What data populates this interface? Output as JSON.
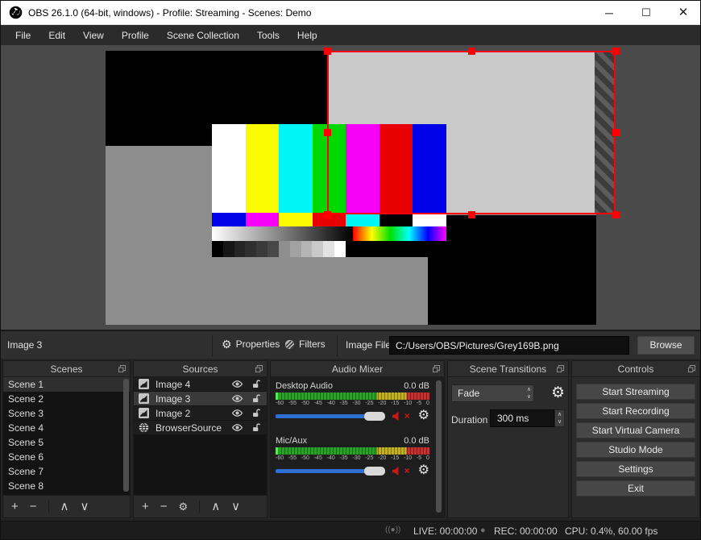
{
  "window": {
    "title": "OBS 26.1.0 (64-bit, windows) - Profile: Streaming - Scenes: Demo",
    "minimize": "–",
    "maximize": "❐",
    "close": "×"
  },
  "menu": {
    "items": [
      "File",
      "Edit",
      "View",
      "Profile",
      "Scene Collection",
      "Tools",
      "Help"
    ]
  },
  "preview": {
    "background_color": "#4a4a4a",
    "canvas_color": "#8d8d8d",
    "selected_image_color": "#c9c9c9",
    "selection_color": "#ff0000",
    "colorbar": {
      "main_colors": [
        "#ffffff",
        "#fbfb00",
        "#00f6f6",
        "#00d800",
        "#f600f6",
        "#e90000",
        "#0000e9"
      ],
      "small_colors": [
        "#0000e9",
        "#f600f6",
        "#fbfb00",
        "#e90000",
        "#00f6f6",
        "#000000",
        "#ffffff"
      ],
      "grayscale_gradient": [
        "#ffffff",
        "#000000"
      ],
      "rainbow_gradient": [
        "#ff0000",
        "#ffff00",
        "#00e000",
        "#00ffff",
        "#0000ff",
        "#ff00ff"
      ],
      "step_colors": [
        "#000000",
        "#161616",
        "#242424",
        "#2f2f2f",
        "#3a3a3a",
        "#484848",
        "#8f8f8f",
        "#a2a2a2",
        "#b5b5b5",
        "#c9c9c9",
        "#e2e2e2",
        "#ffffff"
      ]
    }
  },
  "toolbar": {
    "selected_source": "Image 3",
    "properties_label": "Properties",
    "filters_label": "Filters",
    "image_file_label": "Image File",
    "image_file_value": "C:/Users/OBS/Pictures/Grey169B.png",
    "browse_label": "Browse"
  },
  "scenes": {
    "title": "Scenes",
    "items": [
      "Scene 1",
      "Scene 2",
      "Scene 3",
      "Scene 4",
      "Scene 5",
      "Scene 6",
      "Scene 7",
      "Scene 8"
    ],
    "selected": "Scene 1",
    "toolbar": {
      "add": "+",
      "remove": "−",
      "up": "∧",
      "down": "∨"
    }
  },
  "sources": {
    "title": "Sources",
    "items": [
      {
        "label": "Image 4",
        "icon": "image-icon",
        "selected": false
      },
      {
        "label": "Image 3",
        "icon": "image-icon",
        "selected": true
      },
      {
        "label": "Image 2",
        "icon": "image-icon",
        "selected": false
      },
      {
        "label": "BrowserSource",
        "icon": "globe-icon",
        "selected": false
      }
    ],
    "toolbar": {
      "add": "+",
      "remove": "−",
      "gear": "⚙",
      "up": "∧",
      "down": "∨"
    }
  },
  "audio_mixer": {
    "title": "Audio Mixer",
    "scale_ticks": [
      "-60",
      "-55",
      "-50",
      "-45",
      "-40",
      "-35",
      "-30",
      "-25",
      "-20",
      "-15",
      "-10",
      "-5",
      "0"
    ],
    "channels": [
      {
        "name": "Desktop Audio",
        "level_db": "0.0 dB",
        "muted": true
      },
      {
        "name": "Mic/Aux",
        "level_db": "0.0 dB",
        "muted": true
      }
    ],
    "meter_colors": {
      "green": "#2f9e2f",
      "yellow": "#c0b02a",
      "red": "#bc3434"
    },
    "slider_color": "#2e6fd4"
  },
  "transitions": {
    "title": "Scene Transitions",
    "selected_transition": "Fade",
    "duration_label": "Duration",
    "duration_value": "300 ms",
    "gear": "⚙"
  },
  "controls": {
    "title": "Controls",
    "buttons": [
      "Start Streaming",
      "Start Recording",
      "Start Virtual Camera",
      "Studio Mode",
      "Settings",
      "Exit"
    ]
  },
  "status": {
    "live": "LIVE: 00:00:00",
    "rec": "REC: 00:00:00",
    "cpu": "CPU: 0.4%, 60.00 fps"
  }
}
